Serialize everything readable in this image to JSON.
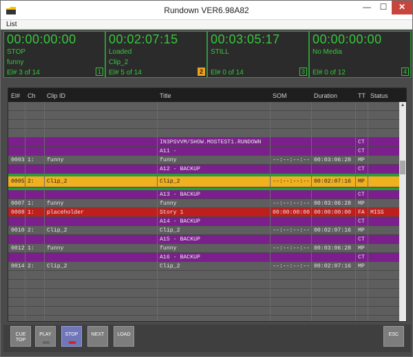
{
  "window": {
    "title": "Rundown VER6.98A82",
    "min_glyph": "—",
    "max_glyph": "☐",
    "close_glyph": "✕"
  },
  "menu": {
    "list": "List"
  },
  "timers": [
    {
      "timecode": "00:00:00:00",
      "status": "STOP",
      "clip": "funny",
      "element": "El# 3 of 14",
      "number": "1"
    },
    {
      "timecode": "00:02:07:15",
      "status": "Loaded",
      "clip": "Clip_2",
      "element": "El# 5 of 14",
      "number": "2"
    },
    {
      "timecode": "00:03:05:17",
      "status": "STILL",
      "clip": "",
      "element": "El# 0 of 14",
      "number": "3"
    },
    {
      "timecode": "00:00:00:00",
      "status": "No Media",
      "clip": "",
      "element": "El# 0 of 12",
      "number": "4"
    }
  ],
  "columns": {
    "el": "El#",
    "ch": "Ch",
    "clip": "Clip ID",
    "title": "Title",
    "som": "SOM",
    "duration": "Duration",
    "tt": "TT",
    "status": "Status"
  },
  "rows": [
    {
      "style": "empty",
      "el": "",
      "ch": "",
      "clip": "",
      "title": "",
      "som": "",
      "duration": "",
      "tt": "",
      "status": ""
    },
    {
      "style": "empty",
      "el": "",
      "ch": "",
      "clip": "",
      "title": "",
      "som": "",
      "duration": "",
      "tt": "",
      "status": ""
    },
    {
      "style": "empty",
      "el": "",
      "ch": "",
      "clip": "",
      "title": "",
      "som": "",
      "duration": "",
      "tt": "",
      "status": ""
    },
    {
      "style": "empty",
      "el": "",
      "ch": "",
      "clip": "",
      "title": "",
      "som": "",
      "duration": "",
      "tt": "",
      "status": ""
    },
    {
      "style": "purple",
      "el": "",
      "ch": "",
      "clip": "",
      "title": "IN3PSVVM/SHOW.MOSTEST1.RUNDOWN",
      "som": "",
      "duration": "",
      "tt": "CT",
      "status": ""
    },
    {
      "style": "purple",
      "el": "",
      "ch": "",
      "clip": "",
      "title": "A11 -",
      "som": "",
      "duration": "",
      "tt": "CT",
      "status": ""
    },
    {
      "style": "grey",
      "el": "0003",
      "ch": "1:",
      "clip": "funny",
      "title": "funny",
      "som": "--:--:--:--",
      "duration": "00:03:06:28",
      "tt": "MP",
      "status": ""
    },
    {
      "style": "purple",
      "el": "",
      "ch": "",
      "clip": "",
      "title": "A12 - BACKUP",
      "som": "",
      "duration": "",
      "tt": "CT",
      "status": ""
    },
    {
      "style": "green",
      "el": "",
      "ch": "",
      "clip": "",
      "title": "",
      "som": "",
      "duration": "",
      "tt": "",
      "status": ""
    },
    {
      "style": "yellow",
      "el": "0005",
      "ch": "2:",
      "clip": "Clip_2",
      "title": "Clip_2",
      "som": "--:--:--:--",
      "duration": "00:02:07:16",
      "tt": "MP",
      "status": ""
    },
    {
      "style": "green",
      "el": "",
      "ch": "",
      "clip": "",
      "title": "",
      "som": "",
      "duration": "",
      "tt": "",
      "status": ""
    },
    {
      "style": "purple",
      "el": "",
      "ch": "",
      "clip": "",
      "title": "A13 - BACKUP",
      "som": "",
      "duration": "",
      "tt": "CT",
      "status": ""
    },
    {
      "style": "grey",
      "el": "0007",
      "ch": "1:",
      "clip": "funny",
      "title": "funny",
      "som": "--:--:--:--",
      "duration": "00:03:06:28",
      "tt": "MP",
      "status": ""
    },
    {
      "style": "red",
      "el": "0008",
      "ch": "1:",
      "clip": "placeholder",
      "title": "Story 1",
      "som": "00:00:00:00",
      "duration": "00:00:00:00",
      "tt": "FA",
      "status": "MISS"
    },
    {
      "style": "purple",
      "el": "",
      "ch": "",
      "clip": "",
      "title": "A14 - BACKUP",
      "som": "",
      "duration": "",
      "tt": "CT",
      "status": ""
    },
    {
      "style": "grey",
      "el": "0010",
      "ch": "2:",
      "clip": "Clip_2",
      "title": "Clip_2",
      "som": "--:--:--:--",
      "duration": "00:02:07:16",
      "tt": "MP",
      "status": ""
    },
    {
      "style": "purple",
      "el": "",
      "ch": "",
      "clip": "",
      "title": "A15 - BACKUP",
      "som": "",
      "duration": "",
      "tt": "CT",
      "status": ""
    },
    {
      "style": "grey",
      "el": "0012",
      "ch": "1:",
      "clip": "funny",
      "title": "funny",
      "som": "--:--:--:--",
      "duration": "00:03:06:28",
      "tt": "MP",
      "status": ""
    },
    {
      "style": "purple",
      "el": "",
      "ch": "",
      "clip": "",
      "title": "A16 - BACKUP",
      "som": "",
      "duration": "",
      "tt": "CT",
      "status": ""
    },
    {
      "style": "grey",
      "el": "0014",
      "ch": "2:",
      "clip": "Clip_2",
      "title": "Clip_2",
      "som": "--:--:--:--",
      "duration": "00:02:07:16",
      "tt": "MP",
      "status": ""
    },
    {
      "style": "empty",
      "el": "",
      "ch": "",
      "clip": "",
      "title": "",
      "som": "",
      "duration": "",
      "tt": "",
      "status": ""
    },
    {
      "style": "empty",
      "el": "",
      "ch": "",
      "clip": "",
      "title": "",
      "som": "",
      "duration": "",
      "tt": "",
      "status": ""
    },
    {
      "style": "empty",
      "el": "",
      "ch": "",
      "clip": "",
      "title": "",
      "som": "",
      "duration": "",
      "tt": "",
      "status": ""
    },
    {
      "style": "empty",
      "el": "",
      "ch": "",
      "clip": "",
      "title": "",
      "som": "",
      "duration": "",
      "tt": "",
      "status": ""
    },
    {
      "style": "empty",
      "el": "",
      "ch": "",
      "clip": "",
      "title": "",
      "som": "",
      "duration": "",
      "tt": "",
      "status": ""
    },
    {
      "style": "empty",
      "el": "",
      "ch": "",
      "clip": "",
      "title": "",
      "som": "",
      "duration": "",
      "tt": "",
      "status": ""
    }
  ],
  "toolbar": {
    "cue_top": "CUE TOP",
    "play": "PLAY",
    "stop": "STOP",
    "next": "NEXT",
    "load": "LOAD",
    "esc": "ESC"
  },
  "colors": {
    "timecode_green": "#36c83b",
    "active_yellow": "#f0b020",
    "purple_row": "#7a1f8c",
    "red_row": "#c21d1d",
    "stop_active": "#7077b8"
  }
}
